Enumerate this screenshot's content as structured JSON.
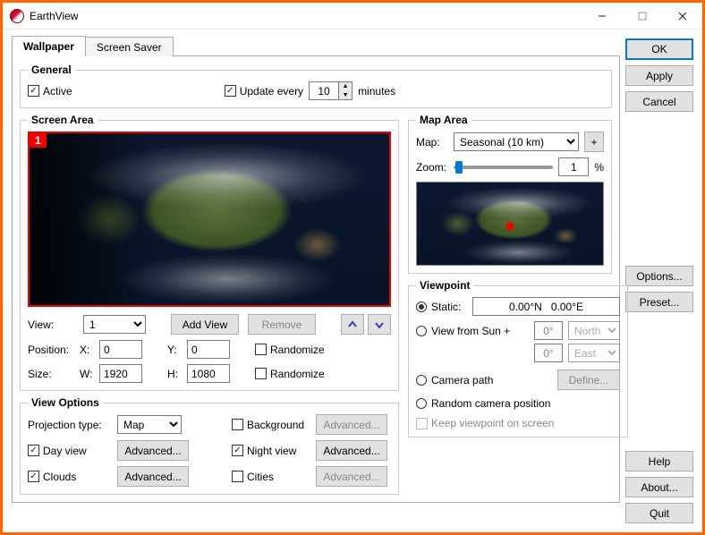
{
  "window": {
    "title": "EarthView"
  },
  "sidebar": {
    "ok": "OK",
    "apply": "Apply",
    "cancel": "Cancel",
    "options": "Options...",
    "preset": "Preset...",
    "help": "Help",
    "about": "About...",
    "quit": "Quit"
  },
  "tabs": {
    "wallpaper": "Wallpaper",
    "screensaver": "Screen Saver"
  },
  "general": {
    "legend": "General",
    "active": "Active",
    "update_every": "Update every",
    "interval": "10",
    "minutes": "minutes"
  },
  "screen_area": {
    "legend": "Screen Area",
    "badge": "1",
    "view_label": "View:",
    "view_value": "1",
    "add_view": "Add View",
    "remove": "Remove",
    "position_label": "Position:",
    "x_label": "X:",
    "x_value": "0",
    "y_label": "Y:",
    "y_value": "0",
    "size_label": "Size:",
    "w_label": "W:",
    "w_value": "1920",
    "h_label": "H:",
    "h_value": "1080",
    "randomize": "Randomize"
  },
  "map_area": {
    "legend": "Map Area",
    "map_label": "Map:",
    "map_value": "Seasonal (10 km)",
    "plus": "+",
    "zoom_label": "Zoom:",
    "zoom_value": "1",
    "zoom_unit": "%"
  },
  "viewpoint": {
    "legend": "Viewpoint",
    "static": "Static:",
    "static_value": "0.00°N   0.00°E",
    "view_from_sun": "View from Sun +",
    "sun_deg1": "0°",
    "sun_dir1": "North",
    "sun_deg2": "0°",
    "sun_dir2": "East",
    "camera_path": "Camera path",
    "define": "Define...",
    "random": "Random camera position",
    "keep": "Keep viewpoint on screen"
  },
  "view_options": {
    "legend": "View Options",
    "projection_label": "Projection type:",
    "projection_value": "Map",
    "day_view": "Day view",
    "clouds": "Clouds",
    "background": "Background",
    "night_view": "Night view",
    "cities": "Cities",
    "advanced": "Advanced..."
  }
}
